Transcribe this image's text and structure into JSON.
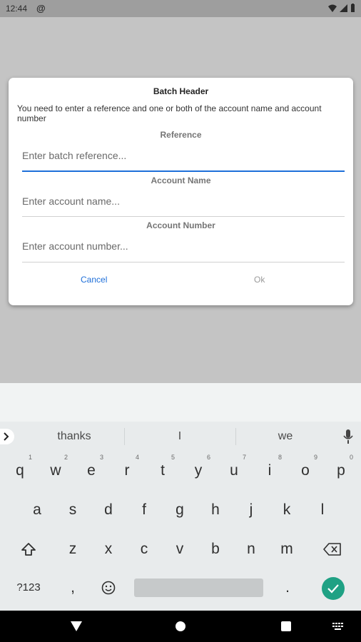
{
  "status_bar": {
    "time": "12:44",
    "app_icon": "at-sign-icon"
  },
  "dialog": {
    "title": "Batch Header",
    "message": "You need to enter a reference and one or both of the account name and account number",
    "fields": [
      {
        "label": "Reference",
        "placeholder": "Enter batch reference...",
        "value": ""
      },
      {
        "label": "Account Name",
        "placeholder": "Enter account name...",
        "value": ""
      },
      {
        "label": "Account Number",
        "placeholder": "Enter account number...",
        "value": ""
      }
    ],
    "cancel_label": "Cancel",
    "ok_label": "Ok"
  },
  "keyboard": {
    "suggestions": [
      "thanks",
      "I",
      "we"
    ],
    "row1": [
      "q",
      "w",
      "e",
      "r",
      "t",
      "y",
      "u",
      "i",
      "o",
      "p"
    ],
    "row1_hints": [
      "1",
      "2",
      "3",
      "4",
      "5",
      "6",
      "7",
      "8",
      "9",
      "0"
    ],
    "row2": [
      "a",
      "s",
      "d",
      "f",
      "g",
      "h",
      "j",
      "k",
      "l"
    ],
    "row3": [
      "z",
      "x",
      "c",
      "v",
      "b",
      "n",
      "m"
    ],
    "symbols_label": "?123",
    "comma": ",",
    "period": "."
  },
  "colors": {
    "accent": "#1e6fd9",
    "enter": "#1fa184"
  }
}
